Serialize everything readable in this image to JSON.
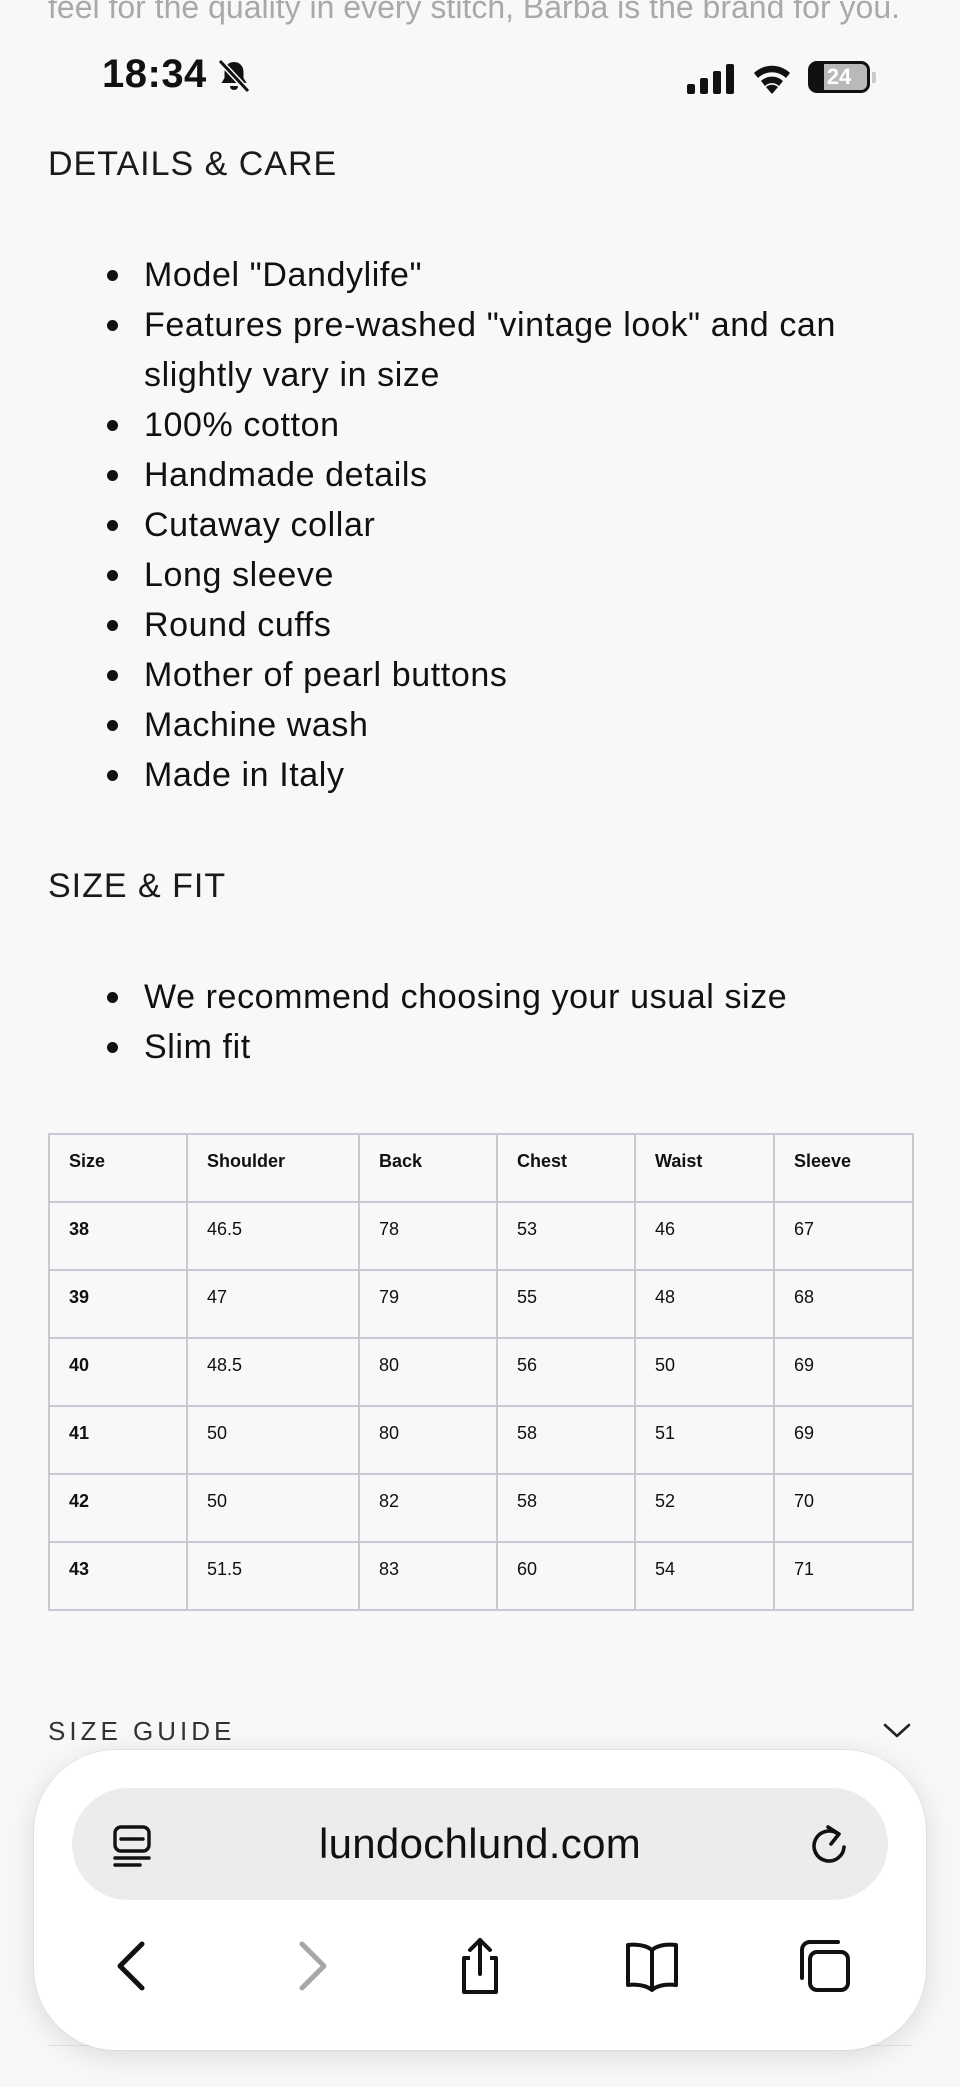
{
  "intro": {
    "text": "feel for the quality in every stitch, Barba is the brand for you."
  },
  "status_bar": {
    "time": "18:34",
    "battery": "24",
    "battery_level": 0.24
  },
  "details": {
    "heading": "DETAILS & CARE",
    "items": [
      "Model \"Dandylife\"",
      "Features pre-washed \"vintage look\" and can slightly vary in size",
      "100% cotton",
      "Handmade details",
      "Cutaway collar",
      "Long sleeve",
      "Round cuffs",
      "Mother of pearl buttons",
      "Machine wash",
      "Made in Italy"
    ]
  },
  "size_fit": {
    "heading": "SIZE & FIT",
    "items": [
      "We recommend choosing your usual size",
      "Slim fit"
    ]
  },
  "size_table": {
    "headers": [
      "Size",
      "Shoulder",
      "Back",
      "Chest",
      "Waist",
      "Sleeve"
    ],
    "rows": [
      [
        "38",
        "46.5",
        "78",
        "53",
        "46",
        "67"
      ],
      [
        "39",
        "47",
        "79",
        "55",
        "48",
        "68"
      ],
      [
        "40",
        "48.5",
        "80",
        "56",
        "50",
        "69"
      ],
      [
        "41",
        "50",
        "80",
        "58",
        "51",
        "69"
      ],
      [
        "42",
        "50",
        "82",
        "58",
        "52",
        "70"
      ],
      [
        "43",
        "51.5",
        "83",
        "60",
        "54",
        "71"
      ]
    ]
  },
  "size_guide": {
    "label": "SIZE GUIDE"
  },
  "browser": {
    "url": "lundochlund.com"
  }
}
